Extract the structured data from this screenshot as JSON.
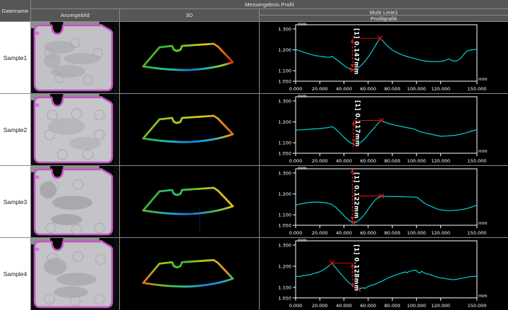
{
  "header": {
    "col_dateiname": "Dateiname",
    "group_title": "Messergebnis Profil",
    "col_anzeigebild": "Anzeigebild",
    "col_3d": "3D",
    "col_multi_linie": "Multi Linie1",
    "col_profilgrafik": "Profilgrafik"
  },
  "axis": {
    "unit": "mm",
    "x_range": [
      0,
      150
    ],
    "y_range": [
      1.05,
      1.32
    ],
    "x_ticks": [
      0,
      20,
      40,
      60,
      80,
      100,
      120,
      150
    ],
    "x_labels": [
      "0.000",
      "20.000",
      "40.000",
      "60.000",
      "80.000",
      "100.000",
      "120.000",
      "150.000"
    ],
    "y_ticks": [
      1.3,
      1.2,
      1.1,
      1.05
    ],
    "y_labels": [
      "1.300",
      "1.200",
      "1.100",
      "1.050"
    ]
  },
  "colors": {
    "curve": "#00d4d4",
    "annotation": "#d81414",
    "axis": "#ffffff",
    "chart_bg": "#000000",
    "part_outline": "#c653c6"
  },
  "samples": [
    {
      "name": "Sample1",
      "measurement": "[1] 0.147mm",
      "min": [
        47,
        1.104
      ],
      "peak": [
        70,
        1.255
      ],
      "dash_x": 47,
      "dash_top": 1.252,
      "profile": [
        [
          0,
          1.202
        ],
        [
          4,
          1.194
        ],
        [
          8,
          1.186
        ],
        [
          12,
          1.179
        ],
        [
          16,
          1.173
        ],
        [
          20,
          1.169
        ],
        [
          24,
          1.166
        ],
        [
          27,
          1.164
        ],
        [
          29,
          1.166
        ],
        [
          30,
          1.169
        ],
        [
          31,
          1.165
        ],
        [
          33,
          1.157
        ],
        [
          36,
          1.144
        ],
        [
          39,
          1.13
        ],
        [
          42,
          1.117
        ],
        [
          45,
          1.108
        ],
        [
          47,
          1.104
        ],
        [
          49,
          1.106
        ],
        [
          52,
          1.115
        ],
        [
          55,
          1.13
        ],
        [
          58,
          1.15
        ],
        [
          61,
          1.174
        ],
        [
          64,
          1.2
        ],
        [
          66,
          1.22
        ],
        [
          68,
          1.24
        ],
        [
          70,
          1.255
        ],
        [
          72,
          1.244
        ],
        [
          74,
          1.23
        ],
        [
          77,
          1.213
        ],
        [
          80,
          1.199
        ],
        [
          84,
          1.186
        ],
        [
          88,
          1.176
        ],
        [
          92,
          1.168
        ],
        [
          96,
          1.162
        ],
        [
          100,
          1.156
        ],
        [
          104,
          1.15
        ],
        [
          108,
          1.146
        ],
        [
          112,
          1.144
        ],
        [
          116,
          1.143
        ],
        [
          120,
          1.145
        ],
        [
          123,
          1.148
        ],
        [
          125,
          1.153
        ],
        [
          127,
          1.156
        ],
        [
          129,
          1.15
        ],
        [
          131,
          1.146
        ],
        [
          134,
          1.149
        ],
        [
          137,
          1.162
        ],
        [
          139,
          1.178
        ],
        [
          141,
          1.19
        ],
        [
          143,
          1.197
        ],
        [
          146,
          1.2
        ],
        [
          150,
          1.203
        ]
      ]
    },
    {
      "name": "Sample2",
      "measurement": "[1] 0.117mm",
      "min": [
        49,
        1.09
      ],
      "peak": [
        71,
        1.207
      ],
      "dash_x": 48,
      "dash_top": 1.203,
      "profile": [
        [
          0,
          1.161
        ],
        [
          5,
          1.162
        ],
        [
          10,
          1.164
        ],
        [
          15,
          1.166
        ],
        [
          20,
          1.168
        ],
        [
          25,
          1.171
        ],
        [
          28,
          1.174
        ],
        [
          30,
          1.177
        ],
        [
          32,
          1.171
        ],
        [
          34,
          1.16
        ],
        [
          37,
          1.144
        ],
        [
          40,
          1.126
        ],
        [
          43,
          1.11
        ],
        [
          46,
          1.098
        ],
        [
          49,
          1.09
        ],
        [
          51,
          1.092
        ],
        [
          54,
          1.102
        ],
        [
          57,
          1.118
        ],
        [
          60,
          1.138
        ],
        [
          63,
          1.158
        ],
        [
          66,
          1.178
        ],
        [
          69,
          1.198
        ],
        [
          71,
          1.207
        ],
        [
          73,
          1.201
        ],
        [
          76,
          1.194
        ],
        [
          80,
          1.187
        ],
        [
          85,
          1.181
        ],
        [
          90,
          1.175
        ],
        [
          95,
          1.169
        ],
        [
          99,
          1.164
        ],
        [
          101,
          1.157
        ],
        [
          104,
          1.151
        ],
        [
          108,
          1.146
        ],
        [
          112,
          1.141
        ],
        [
          116,
          1.136
        ],
        [
          120,
          1.131
        ],
        [
          124,
          1.132
        ],
        [
          128,
          1.134
        ],
        [
          132,
          1.136
        ],
        [
          136,
          1.14
        ],
        [
          140,
          1.146
        ],
        [
          144,
          1.153
        ],
        [
          147,
          1.158
        ],
        [
          150,
          1.164
        ]
      ]
    },
    {
      "name": "Sample3",
      "measurement": "[1] 0.122mm",
      "min": [
        48,
        1.063
      ],
      "peak": [
        71,
        1.19
      ],
      "dash_x": 47,
      "dash_top": 1.318,
      "profile": [
        [
          0,
          1.146
        ],
        [
          5,
          1.153
        ],
        [
          10,
          1.158
        ],
        [
          15,
          1.161
        ],
        [
          20,
          1.16
        ],
        [
          24,
          1.158
        ],
        [
          27,
          1.155
        ],
        [
          30,
          1.149
        ],
        [
          33,
          1.137
        ],
        [
          36,
          1.12
        ],
        [
          39,
          1.102
        ],
        [
          42,
          1.084
        ],
        [
          45,
          1.07
        ],
        [
          47,
          1.064
        ],
        [
          49,
          1.063
        ],
        [
          51,
          1.068
        ],
        [
          54,
          1.082
        ],
        [
          57,
          1.102
        ],
        [
          60,
          1.127
        ],
        [
          63,
          1.151
        ],
        [
          66,
          1.172
        ],
        [
          69,
          1.185
        ],
        [
          71,
          1.19
        ],
        [
          74,
          1.188
        ],
        [
          80,
          1.187
        ],
        [
          86,
          1.187
        ],
        [
          92,
          1.186
        ],
        [
          98,
          1.185
        ],
        [
          101,
          1.182
        ],
        [
          103,
          1.172
        ],
        [
          106,
          1.158
        ],
        [
          109,
          1.148
        ],
        [
          113,
          1.138
        ],
        [
          117,
          1.128
        ],
        [
          121,
          1.123
        ],
        [
          125,
          1.12
        ],
        [
          129,
          1.12
        ],
        [
          133,
          1.122
        ],
        [
          137,
          1.125
        ],
        [
          141,
          1.129
        ],
        [
          145,
          1.136
        ],
        [
          148,
          1.142
        ],
        [
          150,
          1.147
        ]
      ]
    },
    {
      "name": "Sample4",
      "measurement": "[1] 0.128mm",
      "min": [
        52,
        1.09
      ],
      "peak": [
        30,
        1.215
      ],
      "dash_x": 47,
      "dash_top": 1.212,
      "profile": [
        [
          0,
          1.15
        ],
        [
          2,
          1.153
        ],
        [
          4,
          1.151
        ],
        [
          6,
          1.156
        ],
        [
          8,
          1.155
        ],
        [
          10,
          1.16
        ],
        [
          12,
          1.158
        ],
        [
          14,
          1.164
        ],
        [
          16,
          1.167
        ],
        [
          18,
          1.17
        ],
        [
          20,
          1.174
        ],
        [
          22,
          1.18
        ],
        [
          24,
          1.186
        ],
        [
          26,
          1.194
        ],
        [
          28,
          1.204
        ],
        [
          30,
          1.214
        ],
        [
          31,
          1.207
        ],
        [
          33,
          1.194
        ],
        [
          35,
          1.18
        ],
        [
          37,
          1.166
        ],
        [
          39,
          1.153
        ],
        [
          41,
          1.14
        ],
        [
          43,
          1.128
        ],
        [
          45,
          1.118
        ],
        [
          47,
          1.108
        ],
        [
          49,
          1.099
        ],
        [
          51,
          1.092
        ],
        [
          52,
          1.09
        ],
        [
          54,
          1.094
        ],
        [
          56,
          1.099
        ],
        [
          57,
          1.094
        ],
        [
          59,
          1.101
        ],
        [
          61,
          1.106
        ],
        [
          63,
          1.11
        ],
        [
          65,
          1.113
        ],
        [
          67,
          1.118
        ],
        [
          69,
          1.124
        ],
        [
          71,
          1.128
        ],
        [
          73,
          1.134
        ],
        [
          75,
          1.14
        ],
        [
          77,
          1.146
        ],
        [
          79,
          1.15
        ],
        [
          81,
          1.155
        ],
        [
          83,
          1.158
        ],
        [
          85,
          1.163
        ],
        [
          87,
          1.166
        ],
        [
          89,
          1.17
        ],
        [
          91,
          1.173
        ],
        [
          92,
          1.168
        ],
        [
          94,
          1.176
        ],
        [
          96,
          1.178
        ],
        [
          98,
          1.181
        ],
        [
          100,
          1.18
        ],
        [
          101,
          1.172
        ],
        [
          103,
          1.168
        ],
        [
          104,
          1.176
        ],
        [
          106,
          1.17
        ],
        [
          108,
          1.164
        ],
        [
          110,
          1.162
        ],
        [
          112,
          1.159
        ],
        [
          114,
          1.154
        ],
        [
          116,
          1.15
        ],
        [
          118,
          1.147
        ],
        [
          120,
          1.144
        ],
        [
          122,
          1.143
        ],
        [
          124,
          1.141
        ],
        [
          126,
          1.139
        ],
        [
          128,
          1.138
        ],
        [
          130,
          1.136
        ],
        [
          132,
          1.137
        ],
        [
          134,
          1.139
        ],
        [
          136,
          1.141
        ],
        [
          138,
          1.143
        ],
        [
          140,
          1.145
        ],
        [
          142,
          1.148
        ],
        [
          144,
          1.15
        ],
        [
          146,
          1.152
        ],
        [
          148,
          1.151
        ],
        [
          150,
          1.154
        ]
      ]
    }
  ]
}
